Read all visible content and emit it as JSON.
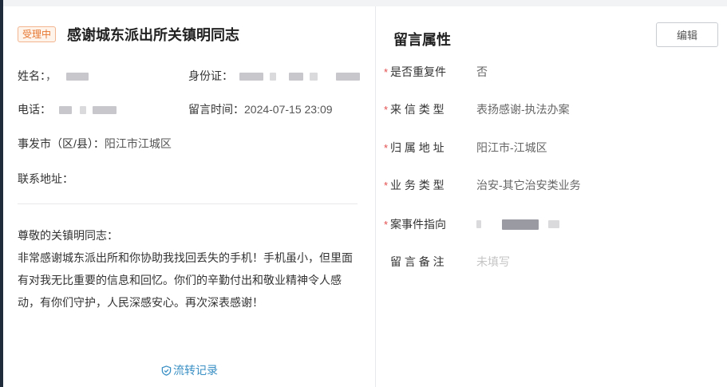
{
  "header": {
    "status_badge": "受理中",
    "title": "感谢城东派出所关镇明同志"
  },
  "info": {
    "name_label": "姓名：",
    "name_prefix": "，",
    "idcard_label": "身份证：",
    "phone_label": "电话：",
    "time_label": "留言时间：",
    "time_value": "2024-07-15 23:09",
    "district_label": "事发市（区/县）：",
    "district_value": "阳江市江城区",
    "address_label": "联系地址："
  },
  "message": {
    "lines": [
      "尊敬的关镇明同志：",
      "非常感谢城东派出所和你协助我找回丢失的手机！手机虽小，但里面",
      "有对我无比重要的信息和回忆。你们的辛勤付出和敬业精神令人感",
      "动，有你们守护，人民深感安心。再次深表感谢！"
    ]
  },
  "history_link": "流转记录",
  "properties": {
    "title": "留言属性",
    "edit_button": "编辑",
    "items": [
      {
        "required": "*",
        "label": "是否重复件",
        "value": "否"
      },
      {
        "required": "*",
        "label": "来 信 类 型",
        "value": "表扬感谢-执法办案"
      },
      {
        "required": "*",
        "label": "归 属 地 址",
        "value": "阳江市-江城区"
      },
      {
        "required": "*",
        "label": "业 务 类 型",
        "value": "治安-其它治安类业务"
      },
      {
        "required": "*",
        "label": "案事件指向",
        "value": ""
      },
      {
        "required": "",
        "label": "留 言 备 注",
        "value": "未填写"
      }
    ]
  },
  "colors": {
    "badge": "#e6762f",
    "link": "#3a8fc4",
    "required": "#e34d4d"
  },
  "icons": {
    "history": "shield-icon"
  }
}
